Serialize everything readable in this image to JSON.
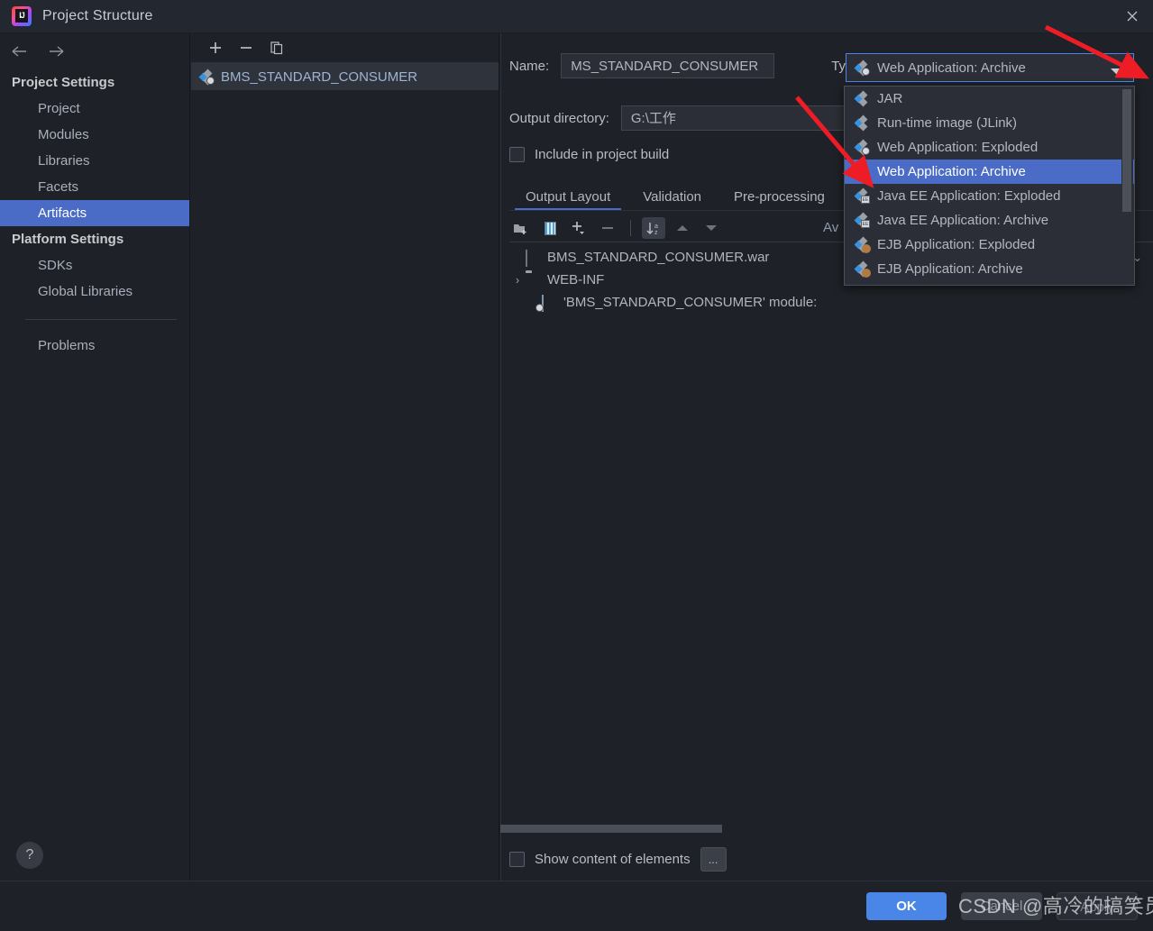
{
  "window": {
    "title": "Project Structure",
    "app_icon": "intellij-idea-logo",
    "close_icon": "close-icon"
  },
  "sidebar": {
    "back_icon": "arrow-left-icon",
    "forward_icon": "arrow-right-icon",
    "groups": [
      {
        "title": "Project Settings",
        "items": [
          {
            "label": "Project",
            "selected": false
          },
          {
            "label": "Modules",
            "selected": false
          },
          {
            "label": "Libraries",
            "selected": false
          },
          {
            "label": "Facets",
            "selected": false
          },
          {
            "label": "Artifacts",
            "selected": true
          }
        ]
      },
      {
        "title": "Platform Settings",
        "items": [
          {
            "label": "SDKs",
            "selected": false
          },
          {
            "label": "Global Libraries",
            "selected": false
          }
        ]
      }
    ],
    "problems_label": "Problems",
    "help_label": "?"
  },
  "artifact_list": {
    "toolbar": [
      {
        "name": "add-artifact-button",
        "glyph": "+"
      },
      {
        "name": "remove-artifact-button",
        "glyph": "−"
      },
      {
        "name": "copy-artifact-button",
        "glyph": "copy-icon"
      }
    ],
    "items": [
      {
        "label": "BMS_STANDARD_CONSUMER",
        "icon": "web-application-archive-icon",
        "selected": true
      }
    ]
  },
  "details": {
    "name_label": "Name:",
    "name_value": "MS_STANDARD_CONSUMER",
    "type_label": "Type:",
    "type_value": "Web Application: Archive",
    "output_directory_label": "Output directory:",
    "output_directory_value": "G:\\工作",
    "include_in_build_label": "Include in project build",
    "include_in_build_checked": false,
    "tabs": [
      {
        "label": "Output Layout",
        "active": true
      },
      {
        "label": "Validation",
        "active": false
      },
      {
        "label": "Pre-processing",
        "active": false
      }
    ],
    "layout_toolbar": [
      {
        "name": "add-directory-button",
        "icon": "folder-add-icon"
      },
      {
        "name": "add-archive-button",
        "icon": "archive-icon"
      },
      {
        "name": "add-copy-of-button",
        "icon": "plus-dropdown-icon"
      },
      {
        "name": "remove-element-button",
        "icon": "minus-icon"
      },
      {
        "name": "sort-button",
        "icon": "sort-az-icon"
      },
      {
        "name": "move-up-button",
        "icon": "chevron-up-icon"
      },
      {
        "name": "move-down-button",
        "icon": "chevron-down-icon"
      }
    ],
    "available_elements_label": "Av",
    "tree": [
      {
        "label": "BMS_STANDARD_CONSUMER.war",
        "icon": "war-archive-icon",
        "indent": 0,
        "chevron": "",
        "collapse_caret": "⌄"
      },
      {
        "label": "WEB-INF",
        "icon": "folder-icon",
        "indent": 0,
        "chevron": "›",
        "collapse_caret": ""
      },
      {
        "label": "'BMS_STANDARD_CONSUMER' module:",
        "icon": "module-output-icon",
        "indent": 1,
        "chevron": "",
        "collapse_caret": ""
      }
    ],
    "show_content_label": "Show content of elements",
    "show_content_checked": false,
    "ellipsis_button_label": "..."
  },
  "type_dropdown": {
    "open": true,
    "options": [
      {
        "label": "JAR",
        "icon": "jar-icon",
        "selected": false
      },
      {
        "label": "Run-time image (JLink)",
        "icon": "jlink-icon",
        "selected": false
      },
      {
        "label": "Web Application: Exploded",
        "icon": "web-exploded-icon",
        "selected": false
      },
      {
        "label": "Web Application: Archive",
        "icon": "web-archive-icon",
        "selected": true
      },
      {
        "label": "Java EE Application: Exploded",
        "icon": "javaee-exploded-icon",
        "selected": false
      },
      {
        "label": "Java EE Application: Archive",
        "icon": "javaee-archive-icon",
        "selected": false
      },
      {
        "label": "EJB Application: Exploded",
        "icon": "ejb-exploded-icon",
        "selected": false
      },
      {
        "label": "EJB Application: Archive",
        "icon": "ejb-archive-icon",
        "selected": false
      }
    ]
  },
  "footer": {
    "ok_label": "OK",
    "cancel_label": "Cancel",
    "apply_label": "Apply"
  },
  "watermark": {
    "text": "CSDN @高冷的搞笑员"
  },
  "colors": {
    "accent_blue": "#4a86e8",
    "selection_blue": "#4a6cc7",
    "background": "#1e2127",
    "titlebar": "#232730",
    "annotation_red": "#ee1c25"
  }
}
